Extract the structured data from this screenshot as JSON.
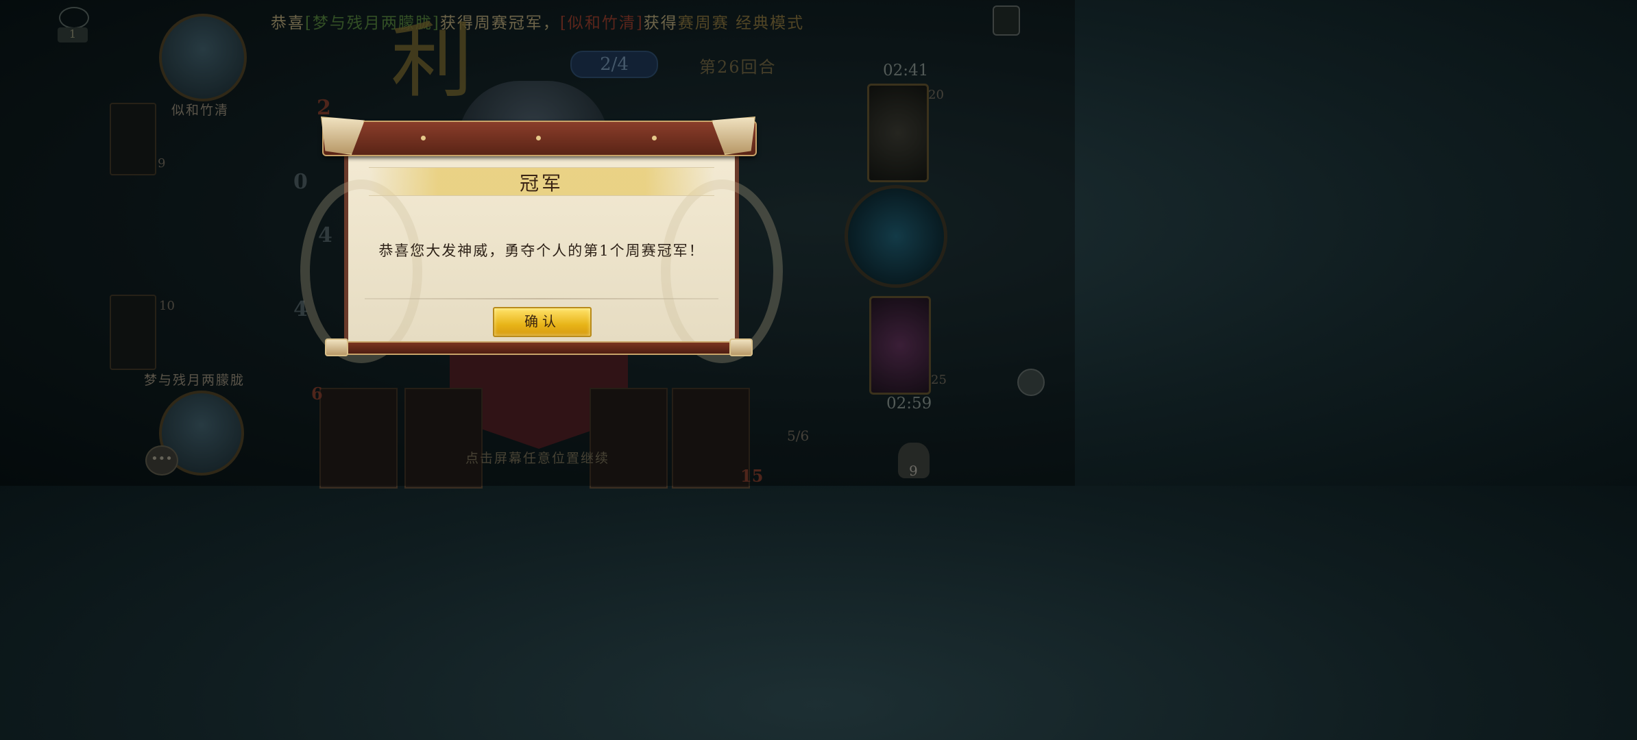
{
  "announcement": {
    "prefix": "恭喜",
    "winner_bracketed": "[梦与残月两朦胧]",
    "mid": "获得周赛冠军，",
    "second_bracketed": "[似和竹清]",
    "second_mid": "获得",
    "mode": "赛周赛 经典模式"
  },
  "hud": {
    "spectator_count": "1",
    "round_progress": "2/4",
    "round_label": "第26回合",
    "timer_top": "02:41",
    "timer_bottom": "02:59",
    "deck_top_count": "20",
    "deck_bottom_count": "25",
    "bag_count": "9",
    "hand_ratio": "5/6",
    "continue_hint": "点击屏幕任意位置继续",
    "victory_glyph": "利"
  },
  "players": {
    "top_name": "似和竹清",
    "bottom_name": "梦与残月两朦胧",
    "top_card_count": "9",
    "bottom_card_count": "10",
    "left_num_1": "2",
    "left_num_2": "0",
    "left_num_3": "4",
    "left_num_4": "4",
    "hand_num_1": "6",
    "hand_num_2": "15"
  },
  "modal": {
    "title": "冠军",
    "message": "恭喜您大发神威，勇夺个人的第1个周赛冠军！",
    "confirm_label": "确认"
  },
  "colors": {
    "confirm_gold": "#e8b418",
    "frame_red": "#7a3420",
    "parchment": "#f3ead3"
  }
}
